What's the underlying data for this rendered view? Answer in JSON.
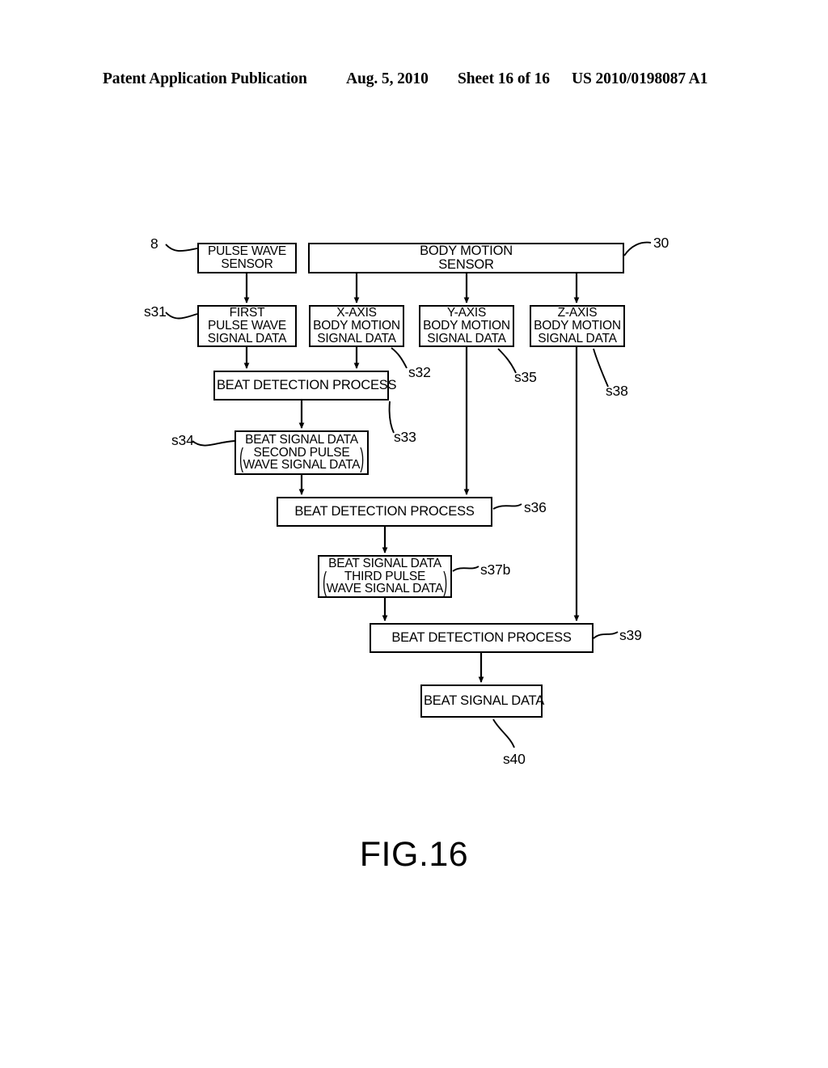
{
  "header": {
    "publication": "Patent Application Publication",
    "date": "Aug. 5, 2010",
    "sheet": "Sheet 16 of 16",
    "patent_number": "US 2010/0198087 A1"
  },
  "figure": {
    "caption": "FIG.16"
  },
  "nodes": {
    "pulse_wave_sensor": {
      "line1": "PULSE WAVE",
      "line2": "SENSOR"
    },
    "body_motion_sensor": {
      "line1": "BODY MOTION",
      "line2": "SENSOR"
    },
    "first_pulse_wave_signal_data": {
      "line1": "FIRST",
      "line2": "PULSE WAVE",
      "line3": "SIGNAL DATA"
    },
    "x_axis_body_motion_signal_data": {
      "line1": "X-AXIS",
      "line2": "BODY MOTION",
      "line3": "SIGNAL DATA"
    },
    "y_axis_body_motion_signal_data": {
      "line1": "Y-AXIS",
      "line2": "BODY MOTION",
      "line3": "SIGNAL DATA"
    },
    "z_axis_body_motion_signal_data": {
      "line1": "Z-AXIS",
      "line2": "BODY MOTION",
      "line3": "SIGNAL DATA"
    },
    "beat_detection_process_1": {
      "line1": "BEAT DETECTION PROCESS"
    },
    "beat_signal_data_second": {
      "line1": "BEAT SIGNAL DATA",
      "line2": "SECOND PULSE",
      "line3": "WAVE SIGNAL DATA"
    },
    "beat_detection_process_2": {
      "line1": "BEAT DETECTION PROCESS"
    },
    "beat_signal_data_third": {
      "line1": "BEAT SIGNAL DATA",
      "line2": "THIRD PULSE",
      "line3": "WAVE SIGNAL DATA"
    },
    "beat_detection_process_3": {
      "line1": "BEAT DETECTION PROCESS"
    },
    "beat_signal_data_final": {
      "line1": "BEAT SIGNAL DATA"
    }
  },
  "refs": {
    "r8": "8",
    "r30": "30",
    "s31": "s31",
    "s32": "s32",
    "s33": "s33",
    "s34": "s34",
    "s35": "s35",
    "s36": "s36",
    "s37b": "s37b",
    "s38": "s38",
    "s39": "s39",
    "s40": "s40"
  },
  "style": {
    "line_color": "#000000",
    "background": "#ffffff"
  }
}
